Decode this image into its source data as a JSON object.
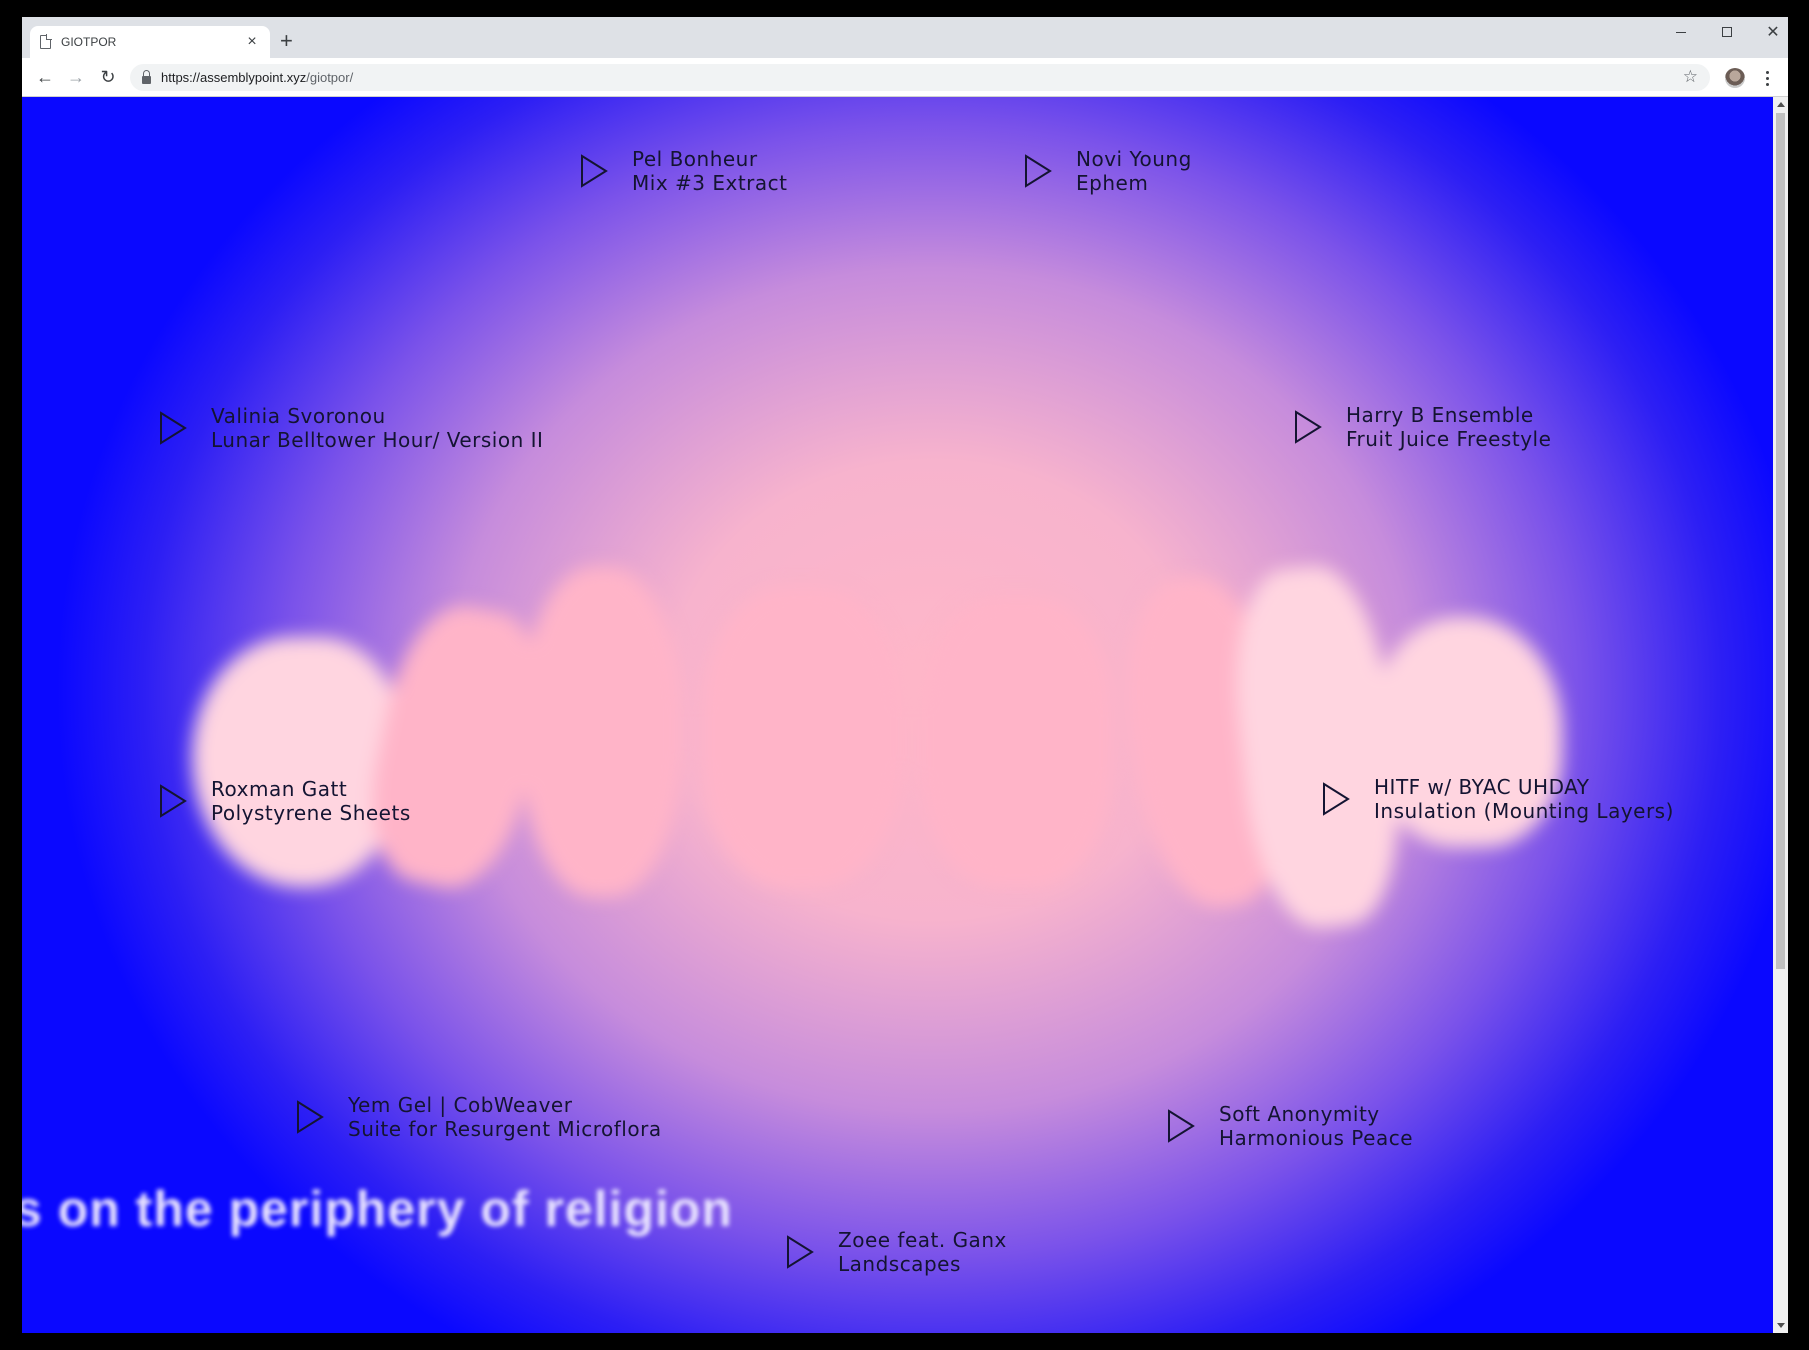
{
  "browser": {
    "tab_title": "GIOTPOR",
    "tab_close": "×",
    "new_tab": "+",
    "url_host": "https://assemblypoint.xyz",
    "url_path": "/giotpor/",
    "icons": [
      "document-icon",
      "close-icon",
      "plus-icon",
      "back-icon",
      "forward-icon",
      "reload-icon",
      "lock-icon",
      "star-icon",
      "avatar",
      "menu-icon",
      "minimize-icon",
      "maximize-icon",
      "close-window-icon"
    ],
    "back": "←",
    "forward": "→",
    "reload": "↻",
    "star": "☆",
    "win_close": "✕"
  },
  "page": {
    "ticker": "s on the periphery of religion",
    "background_colors": {
      "center": "#ffb7c8",
      "edge": "#0a08ff"
    },
    "tracks": [
      {
        "artist": "Pel Bonheur",
        "title": "Mix #3 Extract"
      },
      {
        "artist": "Novi Young",
        "title": "Ephem"
      },
      {
        "artist": "Valinia Svoronou",
        "title": "Lunar Belltower Hour/ Version II"
      },
      {
        "artist": "Harry B Ensemble",
        "title": "Fruit Juice Freestyle"
      },
      {
        "artist": "Roxman Gatt",
        "title": "Polystyrene Sheets"
      },
      {
        "artist": "HITF w/ BYAC UHDAY",
        "title": "Insulation (Mounting Layers)"
      },
      {
        "artist": "Yem Gel | CobWeaver",
        "title": "Suite for Resurgent Microflora"
      },
      {
        "artist": "Soft Anonymity",
        "title": "Harmonious Peace"
      },
      {
        "artist": "Zoee feat. Ganx",
        "title": "Landscapes"
      }
    ]
  }
}
